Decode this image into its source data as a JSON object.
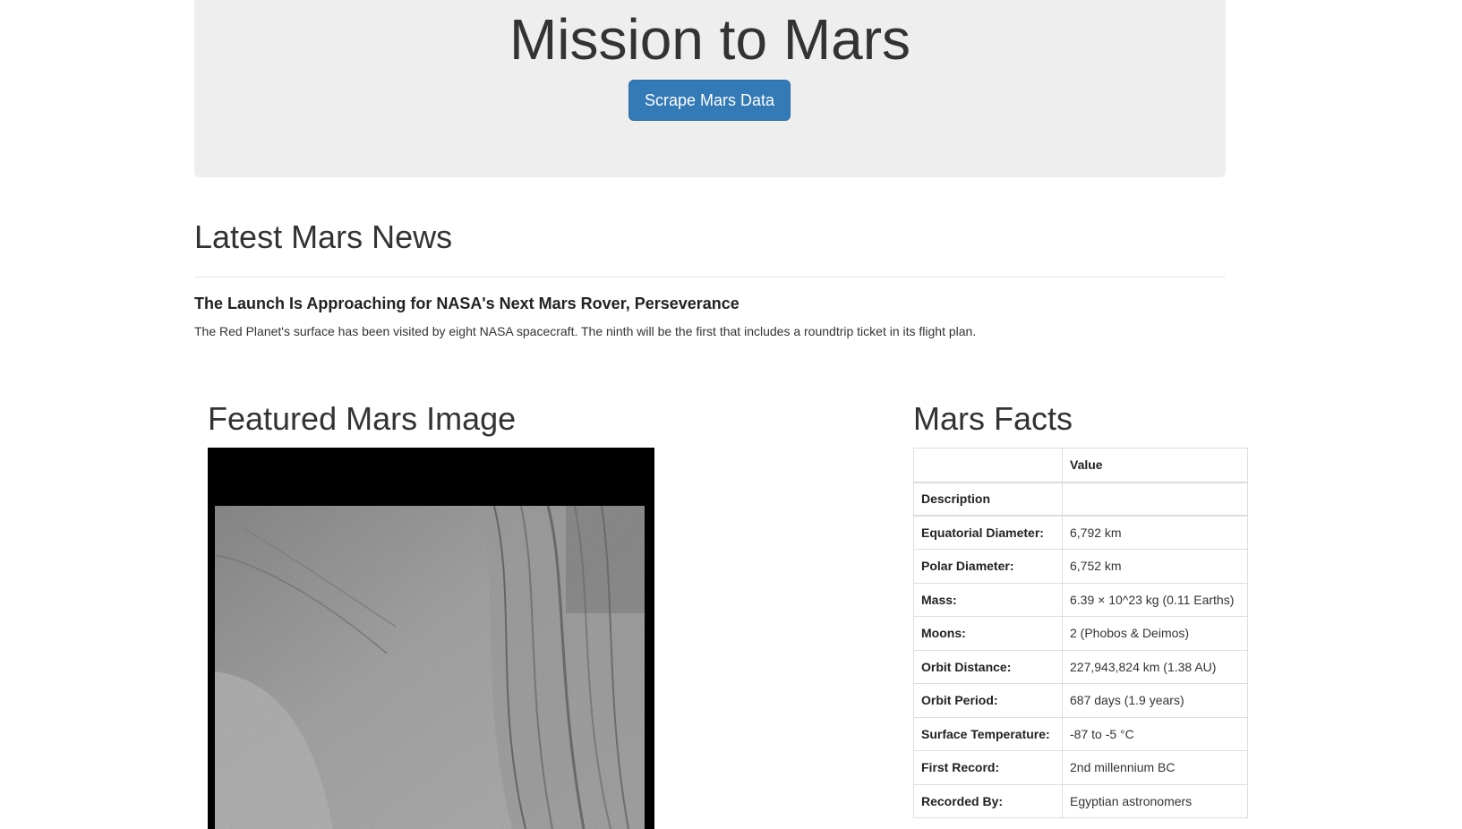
{
  "header": {
    "title": "Mission to Mars",
    "scrape_button_label": "Scrape Mars Data"
  },
  "news": {
    "heading": "Latest Mars News",
    "title": "The Launch Is Approaching for NASA's Next Mars Rover, Perseverance",
    "paragraph": "The Red Planet's surface has been visited by eight NASA spacecraft. The ninth will be the first that includes a roundtrip ticket in its flight plan."
  },
  "featured": {
    "heading": "Featured Mars Image"
  },
  "facts": {
    "heading": "Mars Facts",
    "columns": [
      "",
      "Value"
    ],
    "description_label": "Description",
    "rows": [
      {
        "label": "Equatorial Diameter:",
        "value": "6,792 km"
      },
      {
        "label": "Polar Diameter:",
        "value": "6,752 km"
      },
      {
        "label": "Mass:",
        "value": "6.39 × 10^23 kg (0.11 Earths)"
      },
      {
        "label": "Moons:",
        "value": "2 (Phobos & Deimos)"
      },
      {
        "label": "Orbit Distance:",
        "value": "227,943,824 km (1.38 AU)"
      },
      {
        "label": "Orbit Period:",
        "value": "687 days (1.9 years)"
      },
      {
        "label": "Surface Temperature:",
        "value": "-87 to -5 °C"
      },
      {
        "label": "First Record:",
        "value": "2nd millennium BC"
      },
      {
        "label": "Recorded By:",
        "value": "Egyptian astronomers"
      }
    ]
  },
  "colors": {
    "jumbotron_bg": "#eeeeee",
    "button_bg": "#337ab7",
    "text": "#333333"
  }
}
